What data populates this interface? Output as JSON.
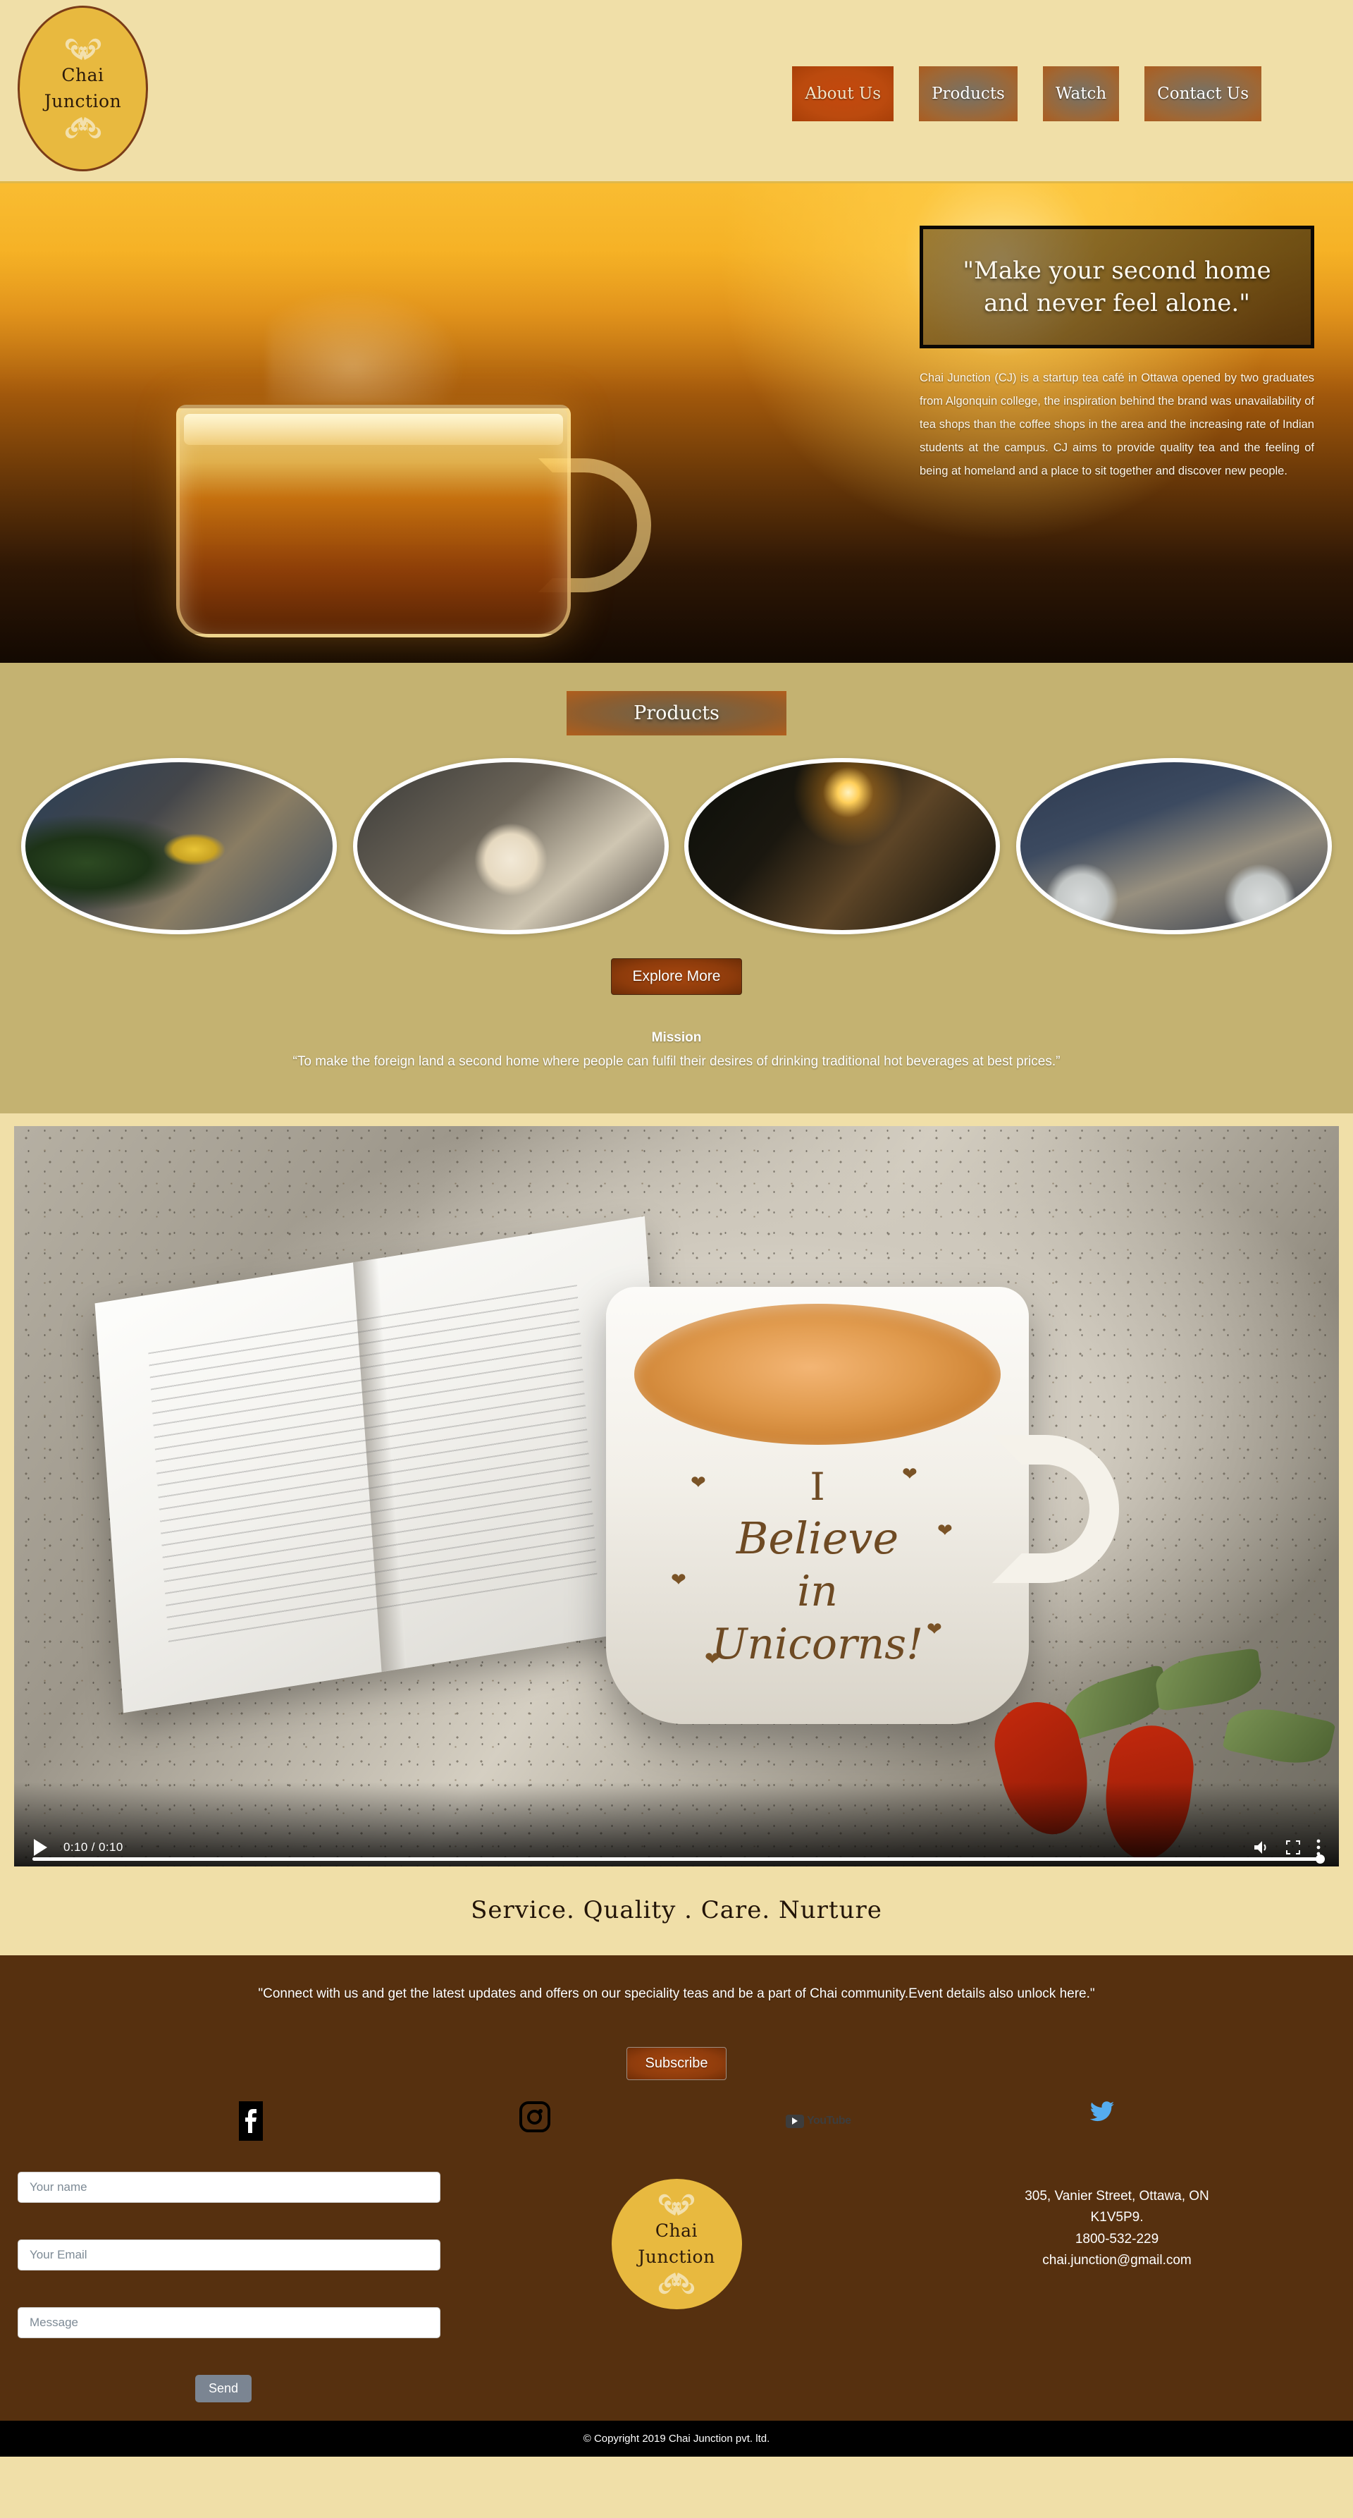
{
  "brand": {
    "name_line1": "Chai",
    "name_line2": "Junction"
  },
  "header": {
    "nav": [
      {
        "label": "About Us",
        "active": true
      },
      {
        "label": "Products",
        "active": false
      },
      {
        "label": "Watch",
        "active": false
      },
      {
        "label": "Contact Us",
        "active": false
      }
    ]
  },
  "hero": {
    "quote": "\"Make your second home and never feel alone.\"",
    "paragraph": "Chai Junction (CJ) is a startup tea café in Ottawa opened by two graduates from Algonquin college, the inspiration behind the brand was unavailability of tea shops than the coffee shops in the area and the increasing rate of Indian students at the campus. CJ aims to provide quality tea and the feeling of being at homeland and a place to sit together and discover new people."
  },
  "products": {
    "heading": "Products",
    "items": [
      {
        "name": "finest-tea-shop-ingredients"
      },
      {
        "name": "chamomile-tea-cup"
      },
      {
        "name": "woman-drinking-tea-by-window"
      },
      {
        "name": "friends-sharing-tea"
      }
    ],
    "explore_label": "Explore More",
    "mission_title": "Mission",
    "mission_text": "“To make the foreign land a second home where people can fulfil their desires of drinking traditional hot beverages at best prices.”"
  },
  "video": {
    "time": "0:10 / 0:10",
    "progress_percent": 100,
    "mug_text_line1": "I",
    "mug_text_line2": "Believe",
    "mug_text_line3": "in",
    "mug_text_line4": "Unicorns!"
  },
  "tagline": "Service. Quality . Care. Nurture",
  "footer": {
    "connect_text": "\"Connect with us and get the latest updates and offers on our speciality teas and be a part of Chai community.Event details also unlock here.\"",
    "subscribe_label": "Subscribe",
    "social": [
      {
        "name": "facebook",
        "label": "f"
      },
      {
        "name": "instagram",
        "label": ""
      },
      {
        "name": "youtube",
        "label": "YouTube"
      },
      {
        "name": "twitter",
        "label": ""
      }
    ],
    "form": {
      "name_placeholder": "Your name",
      "name_value": "",
      "email_placeholder": "Your Email",
      "email_value": "",
      "message_placeholder": "Message",
      "message_value": "",
      "send_label": "Send"
    },
    "address": {
      "line1": "305, Vanier Street, Ottawa, ON",
      "line2": "K1V5P9.",
      "phone": "1800-532-229",
      "email": "chai.junction@gmail.com"
    }
  },
  "copyright": "© Copyright 2019 Chai Junction pvt. ltd.",
  "colors": {
    "cream": "#f0dfa8",
    "gold": "#e8b93f",
    "khaki": "#c4b271",
    "brown": "#56300f",
    "accent_orange": "#a8470f"
  }
}
